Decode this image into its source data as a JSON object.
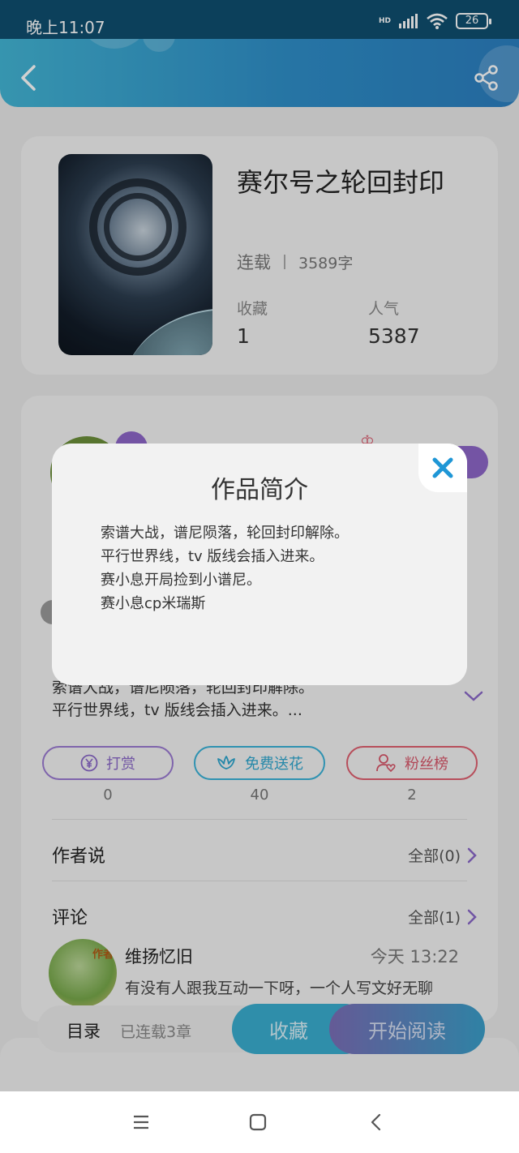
{
  "status_bar": {
    "time": "晚上11:07",
    "hd": "HD",
    "battery": "26"
  },
  "book": {
    "title": "赛尔号之轮回封印",
    "status": "连载",
    "word_count": "3589字",
    "favorites_label": "收藏",
    "favorites_value": "1",
    "popularity_label": "人气",
    "popularity_value": "5387"
  },
  "intro_preview": {
    "line1": "索谱大战，谱尼陨落，轮回封印解除。",
    "line2": "平行世界线，tv 版线会插入进来。..."
  },
  "actions": [
    {
      "label": "打赏",
      "count": "0"
    },
    {
      "label": "免费送花",
      "count": "40"
    },
    {
      "label": "粉丝榜",
      "count": "2"
    }
  ],
  "author_says": {
    "title": "作者说",
    "link": "全部(0)"
  },
  "comments": {
    "title": "评论",
    "link": "全部(1)",
    "item": {
      "tag": "作者",
      "user": "维扬忆旧",
      "time": "今天 13:22",
      "body": "有没有人跟我互动一下呀，一个人写文好无聊"
    }
  },
  "bottom_bar": {
    "toc": "目录",
    "chapters": "已连载3章",
    "favorite": "收藏",
    "start_reading": "开始阅读"
  },
  "modal": {
    "title": "作品简介",
    "lines": [
      "索谱大战，谱尼陨落，轮回封印解除。",
      "平行世界线，tv 版线会插入进来。",
      "赛小息开局捡到小谱尼。",
      "赛小息cp米瑞斯"
    ]
  },
  "colors": {
    "header": "#2f8fc9",
    "purple": "#8a68c8",
    "cyan": "#2fa7cf",
    "red": "#d8566a",
    "close_icon": "#1e96d6"
  }
}
